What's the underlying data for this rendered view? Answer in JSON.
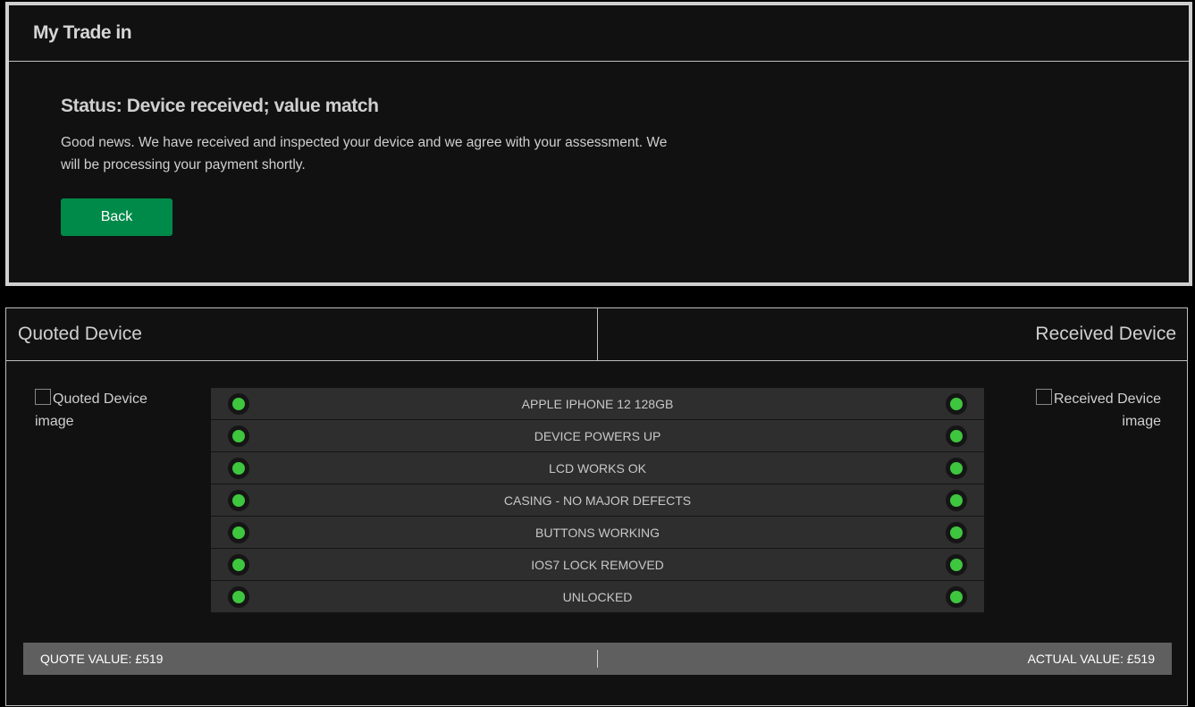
{
  "trade_in": {
    "title": "My Trade in",
    "status_title": "Status: Device received; value match",
    "status_message": "Good news. We have received and inspected your device and we agree with your assessment. We will be processing your payment shortly.",
    "back_label": "Back",
    "back_color": "#008a4a"
  },
  "comparison": {
    "quoted_header": "Quoted Device",
    "received_header": "Received Device",
    "quoted_image_alt": "Quoted Device image",
    "received_image_alt": "Received Device image",
    "check_color": "#3ec63e",
    "items": [
      "APPLE IPHONE 12 128GB",
      "DEVICE POWERS UP",
      "LCD WORKS OK",
      "CASING - NO MAJOR DEFECTS",
      "BUTTONS WORKING",
      "IOS7 LOCK REMOVED",
      "UNLOCKED"
    ],
    "quote_value": "QUOTE VALUE: £519",
    "actual_value": "ACTUAL VALUE: £519"
  }
}
